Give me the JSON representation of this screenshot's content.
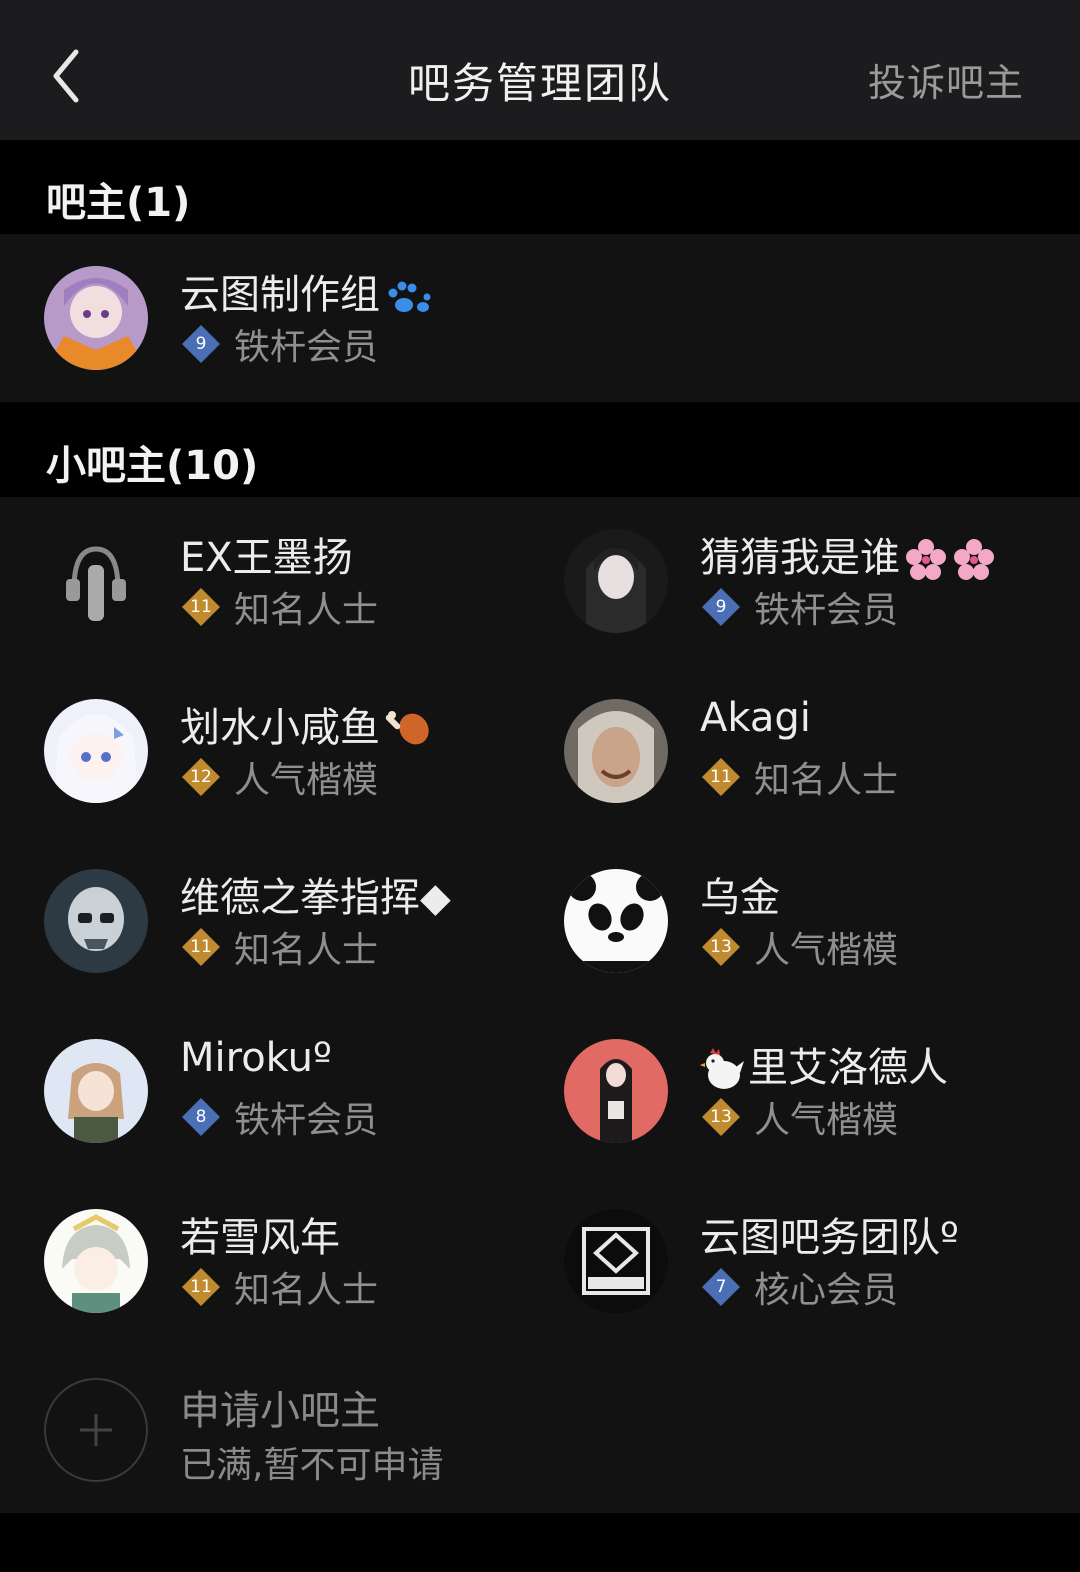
{
  "header": {
    "title": "吧务管理团队",
    "complain_label": "投诉吧主",
    "back_icon": "chevron-left-icon"
  },
  "owner_section": {
    "heading": "吧主(1)",
    "members": [
      {
        "name": "云图制作组",
        "name_suffix": "paw-icon",
        "level": "9",
        "level_color": "#4a6fb5",
        "rank": "铁杆会员"
      }
    ]
  },
  "deputy_section": {
    "heading": "小吧主(10)",
    "members": [
      {
        "name": "EX王墨扬",
        "level": "11",
        "level_color": "#c08a2e",
        "rank": "知名人士"
      },
      {
        "name": "猜猜我是谁",
        "name_suffix": "cherry-blossom-icon",
        "level": "9",
        "level_color": "#4a6fb5",
        "rank": "铁杆会员"
      },
      {
        "name": "划水小咸鱼",
        "name_suffix": "drumstick-icon",
        "level": "12",
        "level_color": "#c08a2e",
        "rank": "人气楷模"
      },
      {
        "name": "Akagi",
        "level": "11",
        "level_color": "#c08a2e",
        "rank": "知名人士"
      },
      {
        "name": "维德之拳指挥◆",
        "level": "11",
        "level_color": "#c08a2e",
        "rank": "知名人士"
      },
      {
        "name": "乌金",
        "level": "13",
        "level_color": "#c08a2e",
        "rank": "人气楷模"
      },
      {
        "name": "Mirokuº",
        "level": "8",
        "level_color": "#4a6fb5",
        "rank": "铁杆会员"
      },
      {
        "name": "里艾洛德人",
        "name_prefix": "chicken-icon",
        "level": "13",
        "level_color": "#c08a2e",
        "rank": "人气楷模"
      },
      {
        "name": "若雪风年",
        "level": "11",
        "level_color": "#c08a2e",
        "rank": "知名人士"
      },
      {
        "name": "云图吧务团队º",
        "level": "7",
        "level_color": "#4a6fb5",
        "rank": "核心会员"
      }
    ],
    "apply": {
      "title": "申请小吧主",
      "subtitle": "已满,暂不可申请"
    }
  }
}
